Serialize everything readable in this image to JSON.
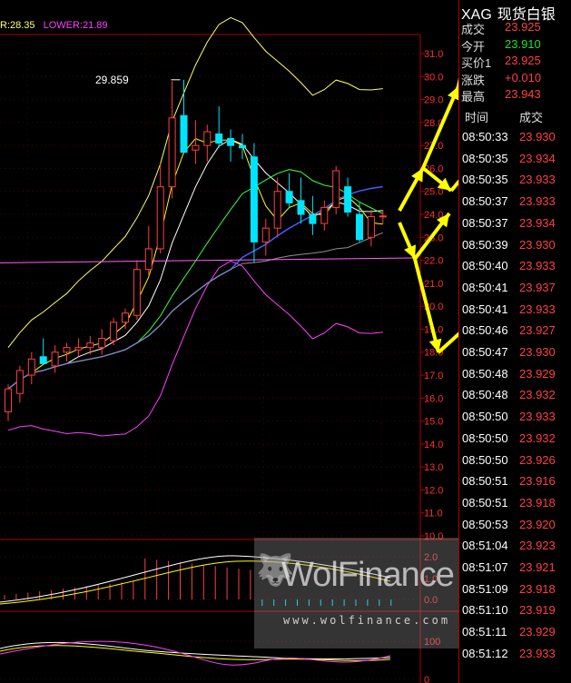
{
  "indicator_line": {
    "upper_text": "R:28.35",
    "lower_text": "LOWER:21.89"
  },
  "annotation": {
    "high_label": "29.859"
  },
  "axis": {
    "main_ticks": [
      "31.0",
      "30.0",
      "29.0",
      "28.0",
      "27.0",
      "26.0",
      "25.0",
      "24.0",
      "23.0",
      "22.0",
      "21.0",
      "20.0",
      "19.0",
      "18.0",
      "17.0",
      "16.0",
      "15.0",
      "14.0",
      "13.0",
      "12.0",
      "11.0",
      "10.0"
    ],
    "macd_ticks": [
      "2.0",
      "1.0",
      "0.0"
    ],
    "kdj_ticks": [
      "100",
      "0"
    ]
  },
  "quote": {
    "code": "XAG",
    "name": "现货白银",
    "rows": [
      {
        "label": "成交",
        "value": "23.925",
        "color": "#ff4040"
      },
      {
        "label": "今开",
        "value": "23.910",
        "color": "#20e020"
      },
      {
        "label": "买价1",
        "value": "23.925",
        "color": "#ff4040"
      },
      {
        "label": "涨跌",
        "value": "+0.010",
        "color": "#ff4040"
      },
      {
        "label": "最高",
        "value": "23.943",
        "color": "#ff4040"
      }
    ],
    "header": {
      "time": "时间",
      "price": "成交"
    },
    "ticks": [
      {
        "time": "08:50:33",
        "price": "23.930"
      },
      {
        "time": "08:50:35",
        "price": "23.934"
      },
      {
        "time": "08:50:35",
        "price": "23.933"
      },
      {
        "time": "08:50:37",
        "price": "23.933"
      },
      {
        "time": "08:50:37",
        "price": "23.934"
      },
      {
        "time": "08:50:39",
        "price": "23.930"
      },
      {
        "time": "08:50:40",
        "price": "23.933"
      },
      {
        "time": "08:50:41",
        "price": "23.937"
      },
      {
        "time": "08:50:41",
        "price": "23.933"
      },
      {
        "time": "08:50:46",
        "price": "23.927"
      },
      {
        "time": "08:50:47",
        "price": "23.930"
      },
      {
        "time": "08:50:48",
        "price": "23.929"
      },
      {
        "time": "08:50:48",
        "price": "23.932"
      },
      {
        "time": "08:50:50",
        "price": "23.933"
      },
      {
        "time": "08:50:50",
        "price": "23.932"
      },
      {
        "time": "08:50:50",
        "price": "23.926"
      },
      {
        "time": "08:50:51",
        "price": "23.916"
      },
      {
        "time": "08:50:51",
        "price": "23.918"
      },
      {
        "time": "08:50:53",
        "price": "23.920"
      },
      {
        "time": "08:51:04",
        "price": "23.923"
      },
      {
        "time": "08:51:07",
        "price": "23.921"
      },
      {
        "time": "08:51:09",
        "price": "23.918"
      },
      {
        "time": "08:51:10",
        "price": "23.919"
      },
      {
        "time": "08:51:11",
        "price": "23.929"
      },
      {
        "time": "08:51:12",
        "price": "23.933"
      }
    ]
  },
  "watermark": {
    "brand": "WolFinance",
    "url": "www.wolfinance.com"
  },
  "colors": {
    "up": "#ff4040",
    "down": "#00e5ff",
    "grid": "#b00000",
    "axis_text": "#ff3030",
    "arrow": "#ffff00"
  },
  "candles": [
    {
      "o": 15.4,
      "h": 16.6,
      "l": 15.0,
      "c": 16.4
    },
    {
      "o": 16.2,
      "h": 17.4,
      "l": 15.8,
      "c": 17.2
    },
    {
      "o": 17.0,
      "h": 18.0,
      "l": 16.6,
      "c": 17.7
    },
    {
      "o": 17.8,
      "h": 18.6,
      "l": 17.5,
      "c": 17.5
    },
    {
      "o": 17.4,
      "h": 18.3,
      "l": 17.1,
      "c": 18.0
    },
    {
      "o": 18.0,
      "h": 18.4,
      "l": 17.6,
      "c": 18.2
    },
    {
      "o": 18.1,
      "h": 18.6,
      "l": 17.8,
      "c": 18.2
    },
    {
      "o": 18.2,
      "h": 18.7,
      "l": 17.9,
      "c": 18.4
    },
    {
      "o": 18.2,
      "h": 19.0,
      "l": 17.9,
      "c": 18.6
    },
    {
      "o": 18.5,
      "h": 19.5,
      "l": 18.3,
      "c": 19.3
    },
    {
      "o": 19.3,
      "h": 19.9,
      "l": 19.0,
      "c": 19.7
    },
    {
      "o": 19.6,
      "h": 22.0,
      "l": 19.4,
      "c": 21.6
    },
    {
      "o": 21.6,
      "h": 23.5,
      "l": 21.3,
      "c": 22.5
    },
    {
      "o": 22.5,
      "h": 26.2,
      "l": 22.3,
      "c": 25.2
    },
    {
      "o": 25.2,
      "h": 29.8,
      "l": 24.7,
      "c": 28.2
    },
    {
      "o": 28.3,
      "h": 29.86,
      "l": 26.7,
      "c": 26.7
    },
    {
      "o": 26.8,
      "h": 28.1,
      "l": 26.2,
      "c": 27.0
    },
    {
      "o": 27.0,
      "h": 27.9,
      "l": 26.3,
      "c": 27.6
    },
    {
      "o": 27.5,
      "h": 28.7,
      "l": 26.9,
      "c": 27.1
    },
    {
      "o": 27.3,
      "h": 27.7,
      "l": 26.3,
      "c": 27.0
    },
    {
      "o": 27.0,
      "h": 27.5,
      "l": 26.4,
      "c": 26.9
    },
    {
      "o": 26.5,
      "h": 27.1,
      "l": 21.9,
      "c": 22.8
    },
    {
      "o": 22.8,
      "h": 23.8,
      "l": 22.2,
      "c": 23.4
    },
    {
      "o": 23.4,
      "h": 25.6,
      "l": 23.0,
      "c": 25.0
    },
    {
      "o": 25.0,
      "h": 25.8,
      "l": 24.3,
      "c": 24.5
    },
    {
      "o": 24.6,
      "h": 25.6,
      "l": 23.6,
      "c": 24.0
    },
    {
      "o": 24.0,
      "h": 24.8,
      "l": 23.1,
      "c": 23.6
    },
    {
      "o": 23.6,
      "h": 24.6,
      "l": 23.3,
      "c": 24.3
    },
    {
      "o": 24.3,
      "h": 26.1,
      "l": 24.0,
      "c": 25.9
    },
    {
      "o": 25.2,
      "h": 25.6,
      "l": 23.9,
      "c": 24.1
    },
    {
      "o": 24.0,
      "h": 24.5,
      "l": 22.8,
      "c": 22.9
    },
    {
      "o": 23.0,
      "h": 24.2,
      "l": 22.6,
      "c": 23.9
    },
    {
      "o": 23.9,
      "h": 24.2,
      "l": 23.6,
      "c": 23.93
    }
  ]
}
